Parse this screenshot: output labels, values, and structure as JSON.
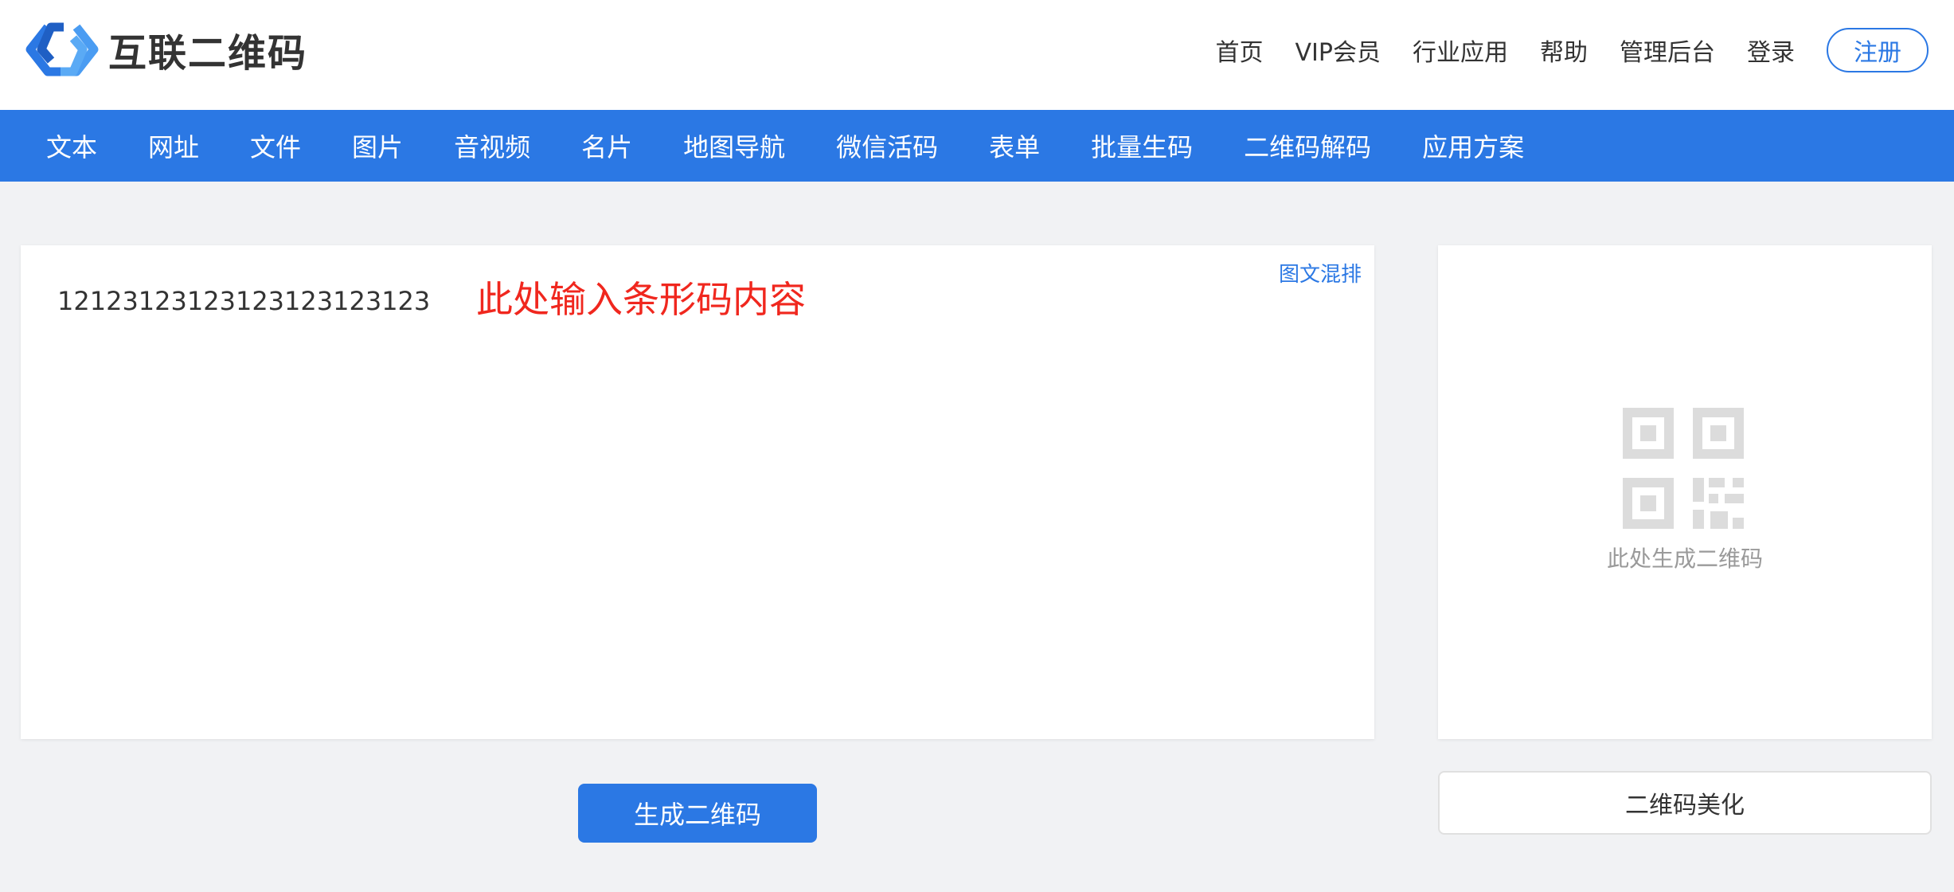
{
  "brand": {
    "name": "互联二维码",
    "logo_icon": "chain-link-logo-icon",
    "accent_color": "#2b78e4"
  },
  "top_nav": {
    "items": [
      "首页",
      "VIP会员",
      "行业应用",
      "帮助",
      "管理后台",
      "登录"
    ],
    "register_label": "注册"
  },
  "tool_bar": {
    "items": [
      "文本",
      "网址",
      "文件",
      "图片",
      "音视频",
      "名片",
      "地图导航",
      "微信活码",
      "表单",
      "批量生码",
      "二维码解码",
      "应用方案"
    ]
  },
  "editor": {
    "value": "12123123123123123123123",
    "hint": "此处输入条形码内容",
    "hint_color": "#f0271e",
    "mix_link_label": "图文混排"
  },
  "preview": {
    "icon": "qr-code-placeholder-icon",
    "hint": "此处生成二维码"
  },
  "buttons": {
    "generate_label": "生成二维码",
    "beautify_label": "二维码美化"
  }
}
